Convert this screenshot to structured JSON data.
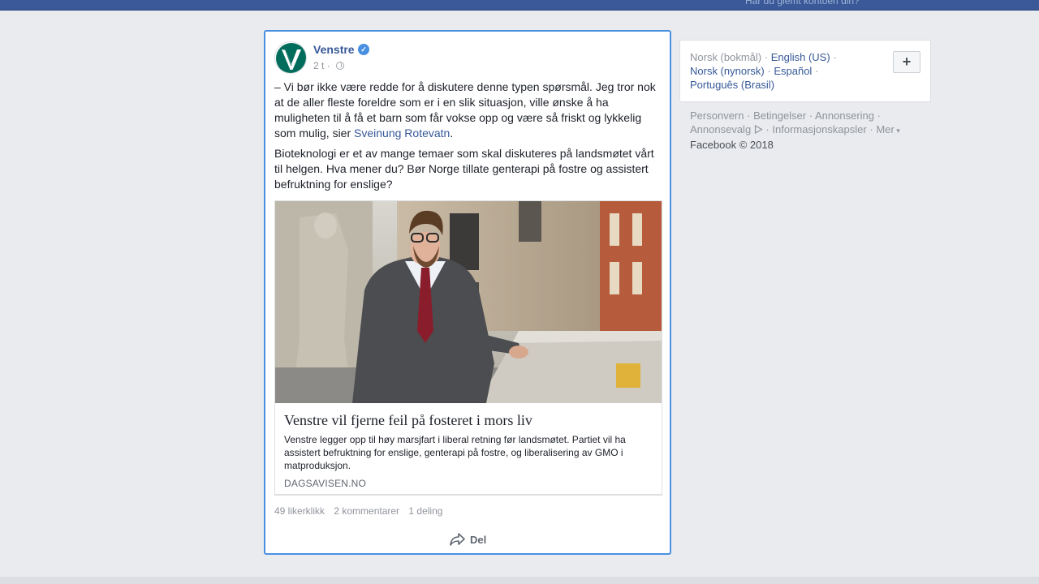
{
  "header": {
    "forgot_account": "Har du glemt kontoen din?"
  },
  "post": {
    "page_name": "Venstre",
    "time": "2 t",
    "meta_separator": "·",
    "body_p1": "– Vi bør ikke være redde for å diskutere denne typen spørsmål. Jeg tror nok at de aller fleste foreldre som er i en slik situasjon, ville ønske å ha muligheten til å få et barn som får vokse opp og være så friskt og lykkelig som mulig, sier",
    "body_p1_link": "Sveinung Rotevatn",
    "body_p1_end": ".",
    "body_p2": "Bioteknologi er et av mange temaer som skal diskuteres på landsmøtet vårt til helgen. Hva mener du? Bør Norge tillate genterapi på fostre og assistert befruktning for enslige?",
    "link_title": "Venstre vil fjerne feil på fosteret i mors liv",
    "link_description": "Venstre legger opp til høy marsjfart i liberal retning før landsmøtet. Partiet vil ha assistert befruktning for enslige, genterapi på fostre, og liberalisering av GMO i matproduksjon.",
    "link_domain": "DAGSAVISEN.NO",
    "likes": "49 likerklikk",
    "comments": "2 kommentarer",
    "shares": "1 deling",
    "share_button": "Del"
  },
  "languages": {
    "current": "Norsk (bokmål)",
    "options": [
      "English (US)",
      "Norsk (nynorsk)",
      "Español",
      "Português (Brasil)"
    ],
    "add_button": "+"
  },
  "footer": {
    "links": [
      "Personvern",
      "Betingelser",
      "Annonsering",
      "Annonsevalg",
      "Informasjonskapsler",
      "Mer"
    ],
    "copyright": "Facebook © 2018"
  },
  "colors": {
    "facebook_blue": "#3b5998",
    "link": "#365899",
    "selection_border": "#4a90e2",
    "venstre_green": "#006c5b"
  },
  "icons": {
    "verified": "verified-badge-icon",
    "audience": "globe-icon",
    "share": "share-arrow-icon",
    "ad_choices": "ad-choices-icon",
    "dropdown": "caret-down-icon"
  }
}
